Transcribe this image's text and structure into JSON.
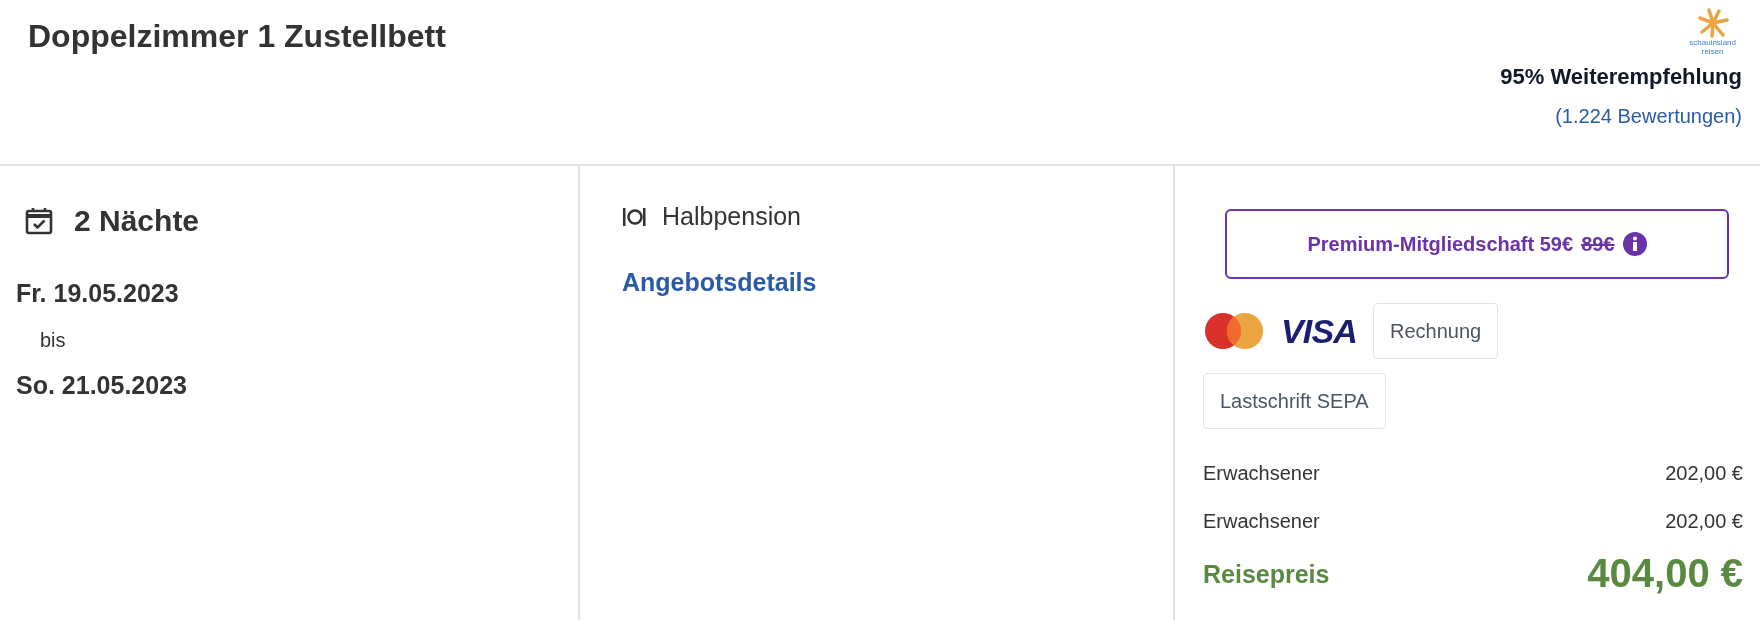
{
  "header": {
    "title": "Doppelzimmer 1 Zustellbett",
    "logo": {
      "line1": "schauinsland",
      "line2": "reisen"
    },
    "recommendation": "95% Weiterempfehlung",
    "reviews_link": "(1.224 Bewertungen)"
  },
  "dates": {
    "nights": "2 Nächte",
    "from": "Fr. 19.05.2023",
    "separator": "bis",
    "to": "So. 21.05.2023"
  },
  "board": {
    "label": "Halbpension",
    "details_link": "Angebotsdetails"
  },
  "premium": {
    "label": "Premium-Mitgliedschaft",
    "price": "59€",
    "old_price": "89€"
  },
  "payment_methods": [
    {
      "kind": "mastercard"
    },
    {
      "kind": "visa",
      "label": "VISA"
    },
    {
      "kind": "text",
      "label": "Rechnung"
    },
    {
      "kind": "text",
      "label": "Lastschrift SEPA"
    }
  ],
  "price_rows": [
    {
      "label": "Erwachsener",
      "amount": "202,00 €"
    },
    {
      "label": "Erwachsener",
      "amount": "202,00 €"
    }
  ],
  "total": {
    "label": "Reisepreis",
    "amount": "404,00 €"
  }
}
